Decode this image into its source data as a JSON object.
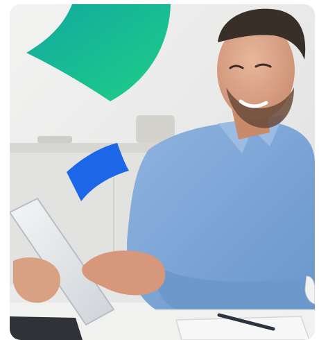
{
  "hero": {
    "photo_icon": "person-with-tablet-photo",
    "shapes": [
      {
        "name": "green-arc-shape",
        "gradient": [
          "#12a8a0",
          "#1fcf86"
        ]
      },
      {
        "name": "blue-arc-shape",
        "color": "#1b67e8"
      }
    ],
    "colors": {
      "wall": "#ecedec",
      "shirt": "#7ea7d6",
      "desk": "#efefef"
    }
  }
}
